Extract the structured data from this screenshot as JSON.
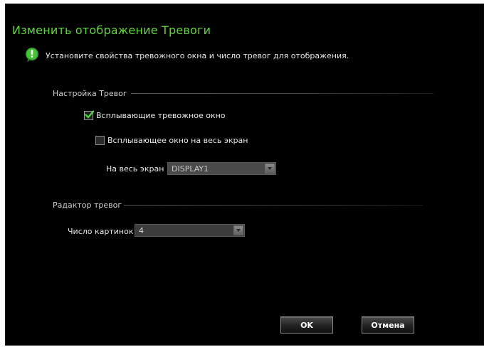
{
  "dialog": {
    "title": "Изменить отображение Тревоги",
    "info_text": "Установите свойства тревожного окна и число тревог для отображения."
  },
  "alarm_settings": {
    "group_label": "Настройка Тревог",
    "popup_window": {
      "label": "Всплывающие тревожное окно",
      "checked": true
    },
    "fullscreen_popup": {
      "label": "Всплывающее окно на весь экран",
      "checked": false
    },
    "fullscreen_display": {
      "label": "На весь экран",
      "value": "DISPLAY1"
    }
  },
  "alarm_editor": {
    "group_label": "Радактор тревог",
    "picture_count": {
      "label": "Число картинок",
      "value": "4"
    }
  },
  "buttons": {
    "ok_label": "OK",
    "cancel_label": "Отмена"
  },
  "colors": {
    "title": "#5fd83a",
    "background": "#000000",
    "check": "#4cd43a"
  },
  "icons": {
    "info": "info-bubble-icon",
    "check": "checkmark-icon",
    "dropdown": "chevron-down-icon"
  }
}
